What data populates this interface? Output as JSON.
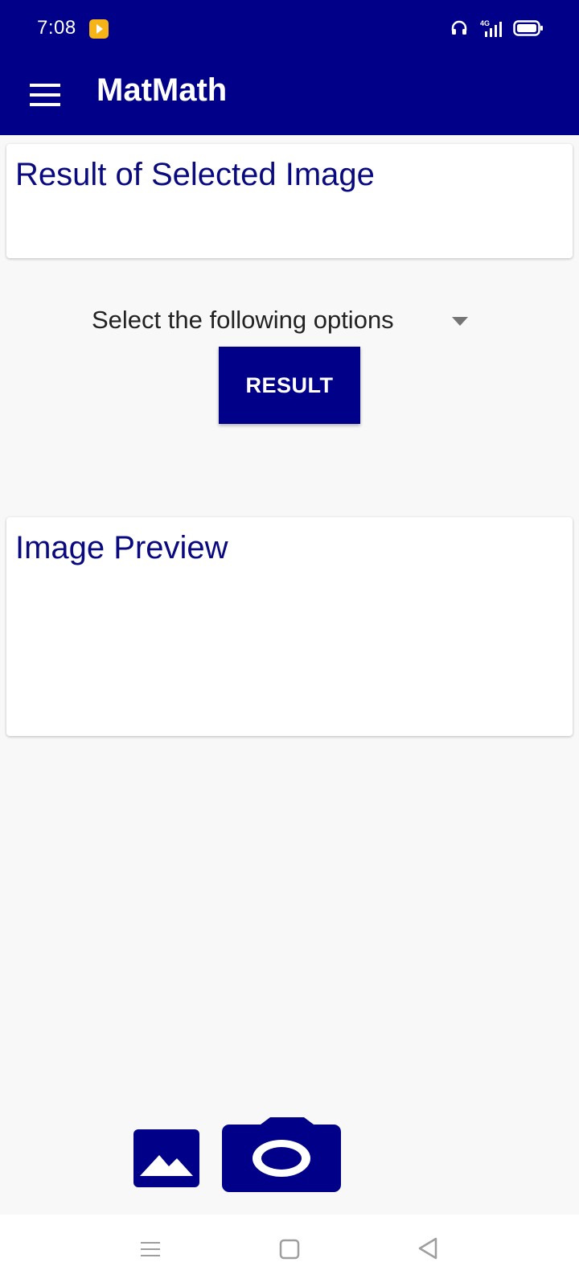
{
  "status_bar": {
    "time": "7:08",
    "network": "4G",
    "notification_icon": "play-app-icon",
    "icons": [
      "headset-icon",
      "signal-icon",
      "battery-icon"
    ]
  },
  "app_bar": {
    "title": "MatMath",
    "menu_icon": "hamburger-menu-icon"
  },
  "result_card": {
    "title": "Result of Selected Image"
  },
  "options": {
    "selected_text": "Select the following options",
    "icon": "dropdown-arrow-icon"
  },
  "result_button": {
    "label": "RESULT"
  },
  "preview_card": {
    "title": "Image Preview"
  },
  "actions": {
    "gallery_icon": "gallery-icon",
    "camera_icon": "camera-icon"
  },
  "nav_bar": {
    "icons": [
      "recent-apps-icon",
      "home-icon",
      "back-icon"
    ]
  },
  "colors": {
    "primary": "#000088",
    "title_text": "#0a0a80",
    "background": "#f8f8f8"
  }
}
